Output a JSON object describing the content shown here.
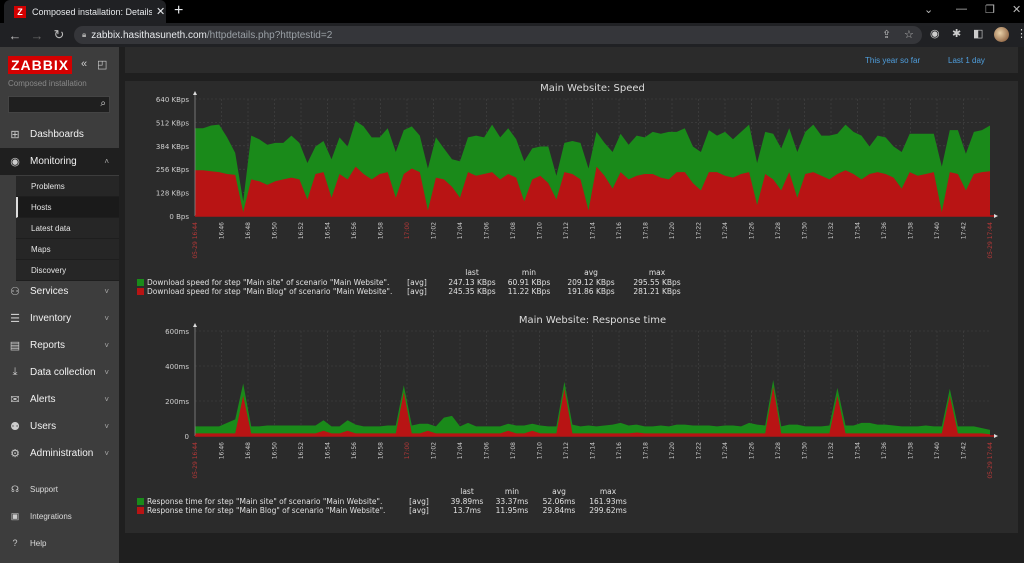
{
  "browser": {
    "tab_title": "Composed installation: Details of",
    "tab_favicon": "Z",
    "url_host": "zabbix.hasithasuneth.com",
    "url_path": "/httpdetails.php?httptestid=2"
  },
  "sidebar": {
    "logo": "ZABBIX",
    "subtitle": "Composed installation",
    "search_placeholder": "",
    "menu": [
      {
        "label": "Dashboards",
        "icon": "dashboard-icon"
      },
      {
        "label": "Monitoring",
        "icon": "eye-icon",
        "expanded": true
      },
      {
        "label": "Services",
        "icon": "services-icon"
      },
      {
        "label": "Inventory",
        "icon": "list-icon"
      },
      {
        "label": "Reports",
        "icon": "report-icon"
      },
      {
        "label": "Data collection",
        "icon": "download-icon"
      },
      {
        "label": "Alerts",
        "icon": "envelope-icon"
      },
      {
        "label": "Users",
        "icon": "users-icon"
      },
      {
        "label": "Administration",
        "icon": "gear-icon"
      }
    ],
    "monitoring_submenu": [
      "Problems",
      "Hosts",
      "Latest data",
      "Maps",
      "Discovery"
    ],
    "selected_submenu": "Hosts",
    "footer": [
      {
        "label": "Support",
        "icon": "headset-icon"
      },
      {
        "label": "Integrations",
        "icon": "zabbix-z-icon"
      },
      {
        "label": "Help",
        "icon": "question-icon"
      }
    ]
  },
  "time_links": [
    "This year so far",
    "Last 1 day"
  ],
  "colors": {
    "series_green": "#1a8a1a",
    "series_red": "#b81414",
    "zabbix_red": "#d40000",
    "link_blue": "#4f9fde"
  },
  "chart_data": [
    {
      "type": "area",
      "title": "Main Website: Speed",
      "y_ticks": [
        "0 Bps",
        "128 KBps",
        "256 KBps",
        "384 KBps",
        "512 KBps",
        "640 KBps"
      ],
      "ylim": [
        0,
        640
      ],
      "y_unit": "KBps",
      "x_start_label": "05-29 16:44",
      "x_end_label": "05-29 17:44",
      "x_ticks": [
        "16:46",
        "16:48",
        "16:50",
        "16:52",
        "16:54",
        "16:56",
        "16:58",
        "17:00",
        "17:02",
        "17:04",
        "17:06",
        "17:08",
        "17:10",
        "17:12",
        "17:14",
        "17:16",
        "17:18",
        "17:20",
        "17:22",
        "17:24",
        "17:26",
        "17:28",
        "17:30",
        "17:32",
        "17:34",
        "17:36",
        "17:38",
        "17:40",
        "17:42"
      ],
      "highlight_ticks": [
        "17:00"
      ],
      "grid": true,
      "stacked": true,
      "series": [
        {
          "name": "Download speed for step \"Main site\" of scenario \"Main Website\".",
          "color": "green",
          "values": [
            230,
            230,
            250,
            260,
            200,
            120,
            60,
            240,
            230,
            220,
            210,
            200,
            230,
            200,
            200,
            150,
            170,
            210,
            200,
            180,
            250,
            260,
            230,
            200,
            240,
            250,
            240,
            230,
            200,
            230,
            220,
            170,
            150,
            200,
            190,
            220,
            200,
            260,
            230,
            250,
            210,
            220,
            170,
            160,
            200,
            130,
            160,
            180,
            200,
            230,
            190,
            180,
            200,
            210,
            190,
            220,
            200,
            230,
            240,
            260,
            220,
            240,
            200,
            210,
            230,
            200,
            240,
            210,
            230,
            260,
            230,
            230,
            250,
            230,
            240,
            250,
            230,
            260,
            220,
            240,
            220,
            250,
            230,
            240,
            150,
            200,
            200,
            170,
            200,
            210,
            230,
            220,
            210,
            250,
            230,
            240,
            200,
            230,
            230,
            250
          ]
        },
        {
          "name": "Download speed for step \"Main Blog\" of scenario \"Main Website\".",
          "color": "red",
          "values": [
            250,
            250,
            245,
            240,
            230,
            225,
            20,
            200,
            190,
            170,
            190,
            200,
            210,
            200,
            90,
            230,
            240,
            100,
            230,
            200,
            270,
            230,
            200,
            230,
            240,
            100,
            230,
            260,
            240,
            30,
            210,
            200,
            160,
            100,
            240,
            220,
            230,
            240,
            200,
            230,
            210,
            80,
            200,
            220,
            180,
            90,
            240,
            230,
            200,
            30,
            270,
            220,
            150,
            240,
            200,
            220,
            230,
            230,
            210,
            200,
            240,
            240,
            180,
            140,
            240,
            240,
            220,
            210,
            230,
            240,
            60,
            230,
            200,
            140,
            240,
            100,
            230,
            240,
            220,
            200,
            230,
            250,
            230,
            200,
            230,
            240,
            230,
            210,
            150,
            240,
            220,
            230,
            240,
            20,
            240,
            230,
            140,
            230,
            240,
            245
          ]
        }
      ],
      "legend": {
        "columns": [
          "last",
          "min",
          "avg",
          "max"
        ],
        "rows": [
          {
            "label": "Download speed for step \"Main site\" of scenario \"Main Website\".",
            "func": "[avg]",
            "last": "247.13 KBps",
            "min": "60.91 KBps",
            "avg": "209.12 KBps",
            "max": "295.55 KBps"
          },
          {
            "label": "Download speed for step \"Main Blog\" of scenario \"Main Website\".",
            "func": "[avg]",
            "last": "245.35 KBps",
            "min": "11.22 KBps",
            "avg": "191.86 KBps",
            "max": "281.21 KBps"
          }
        ]
      }
    },
    {
      "type": "area",
      "title": "Main Website: Response time",
      "y_ticks": [
        "0",
        "200ms",
        "400ms",
        "600ms"
      ],
      "ylim": [
        0,
        600
      ],
      "y_unit": "ms",
      "x_start_label": "05-29 16:44",
      "x_end_label": "05-29 17:44",
      "x_ticks": [
        "16:46",
        "16:48",
        "16:50",
        "16:52",
        "16:54",
        "16:56",
        "16:58",
        "17:00",
        "17:02",
        "17:04",
        "17:06",
        "17:08",
        "17:10",
        "17:12",
        "17:14",
        "17:16",
        "17:18",
        "17:20",
        "17:22",
        "17:24",
        "17:26",
        "17:28",
        "17:30",
        "17:32",
        "17:34",
        "17:36",
        "17:38",
        "17:40",
        "17:42"
      ],
      "highlight_ticks": [
        "17:00"
      ],
      "grid": true,
      "stacked": true,
      "series": [
        {
          "name": "Response time for step \"Main site\" of scenario \"Main Website\".",
          "color": "green",
          "values": [
            40,
            40,
            40,
            40,
            60,
            80,
            70,
            40,
            40,
            45,
            45,
            45,
            45,
            45,
            45,
            45,
            60,
            40,
            40,
            60,
            50,
            40,
            40,
            40,
            45,
            45,
            40,
            45,
            55,
            40,
            40,
            90,
            100,
            40,
            60,
            40,
            40,
            40,
            40,
            40,
            45,
            45,
            40,
            45,
            40,
            40,
            40,
            50,
            40,
            45,
            40,
            45,
            50,
            60,
            45,
            45,
            40,
            40,
            45,
            40,
            50,
            50,
            45,
            45,
            45,
            40,
            45,
            45,
            40,
            60,
            50,
            45,
            40,
            40,
            50,
            50,
            40,
            40,
            40,
            45,
            45,
            45,
            45,
            60,
            60,
            50,
            50,
            45,
            40,
            40,
            40,
            45,
            40,
            40,
            40,
            40,
            40,
            40,
            30,
            25
          ]
        },
        {
          "name": "Response time for step \"Main Blog\" of scenario \"Main Website\".",
          "color": "red",
          "values": [
            15,
            15,
            15,
            15,
            15,
            15,
            230,
            15,
            15,
            15,
            15,
            15,
            15,
            15,
            15,
            15,
            30,
            15,
            15,
            30,
            15,
            15,
            15,
            15,
            15,
            15,
            250,
            15,
            15,
            30,
            15,
            15,
            15,
            15,
            15,
            15,
            15,
            15,
            15,
            30,
            15,
            15,
            30,
            15,
            15,
            15,
            270,
            15,
            15,
            15,
            15,
            15,
            15,
            15,
            15,
            20,
            15,
            15,
            15,
            15,
            15,
            15,
            15,
            15,
            15,
            15,
            15,
            15,
            15,
            15,
            15,
            15,
            280,
            15,
            15,
            15,
            15,
            15,
            15,
            15,
            230,
            15,
            15,
            15,
            15,
            15,
            15,
            15,
            15,
            15,
            15,
            15,
            15,
            15,
            230,
            15,
            15,
            15,
            15,
            10
          ]
        }
      ],
      "legend": {
        "columns": [
          "last",
          "min",
          "avg",
          "max"
        ],
        "rows": [
          {
            "label": "Response time for step \"Main site\" of scenario \"Main Website\".",
            "func": "[avg]",
            "last": "39.89ms",
            "min": "33.37ms",
            "avg": "52.06ms",
            "max": "161.93ms"
          },
          {
            "label": "Response time for step \"Main Blog\" of scenario \"Main Website\".",
            "func": "[avg]",
            "last": "13.7ms",
            "min": "11.95ms",
            "avg": "29.84ms",
            "max": "299.62ms"
          }
        ]
      }
    }
  ]
}
